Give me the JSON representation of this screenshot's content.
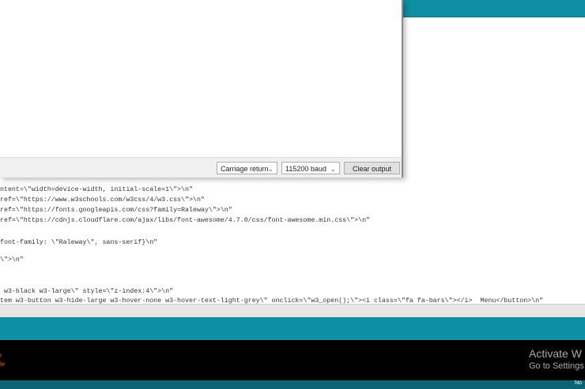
{
  "serial_monitor": {
    "line_ending": "Carriage return",
    "baud": "115200 baud",
    "clear_label": "Clear output"
  },
  "code_lines": [
    "ntent=\\\"width=device-width, initial-scale=1\\\">\\n\"",
    "ref=\\\"https://www.w3schools.com/w3css/4/w3.css\\\">\\n\"",
    "ref=\\\"https://fonts.googleapis.com/css?family=Raleway\\\">\\n\"",
    "ref=\\\"https://cdnjs.cloudflare.com/ajax/libs/font-awesome/4.7.0/css/font-awesome.min.css\\\">\\n\"",
    "font-family: \\\"Raleway\\\", sans-serif}\\n\"",
    "\\\">\\n\"",
    " w3-black w3-large\\\" style=\\\"z-index:4\\\">\\n\"",
    "tem w3-button w3-hide-large w3-hover-none w3-hover-text-light-grey\\\" onclick=\\\"w3_open();\\\"><i class=\\\"fa fa-bars\\\"></i>  Menu</button>\\n\""
  ],
  "console": {
    "line1": "r",
    "line2": "le"
  },
  "watermark": {
    "title": "Activate W",
    "subtitle": "Go to Settings"
  },
  "status": {
    "text": "No"
  }
}
